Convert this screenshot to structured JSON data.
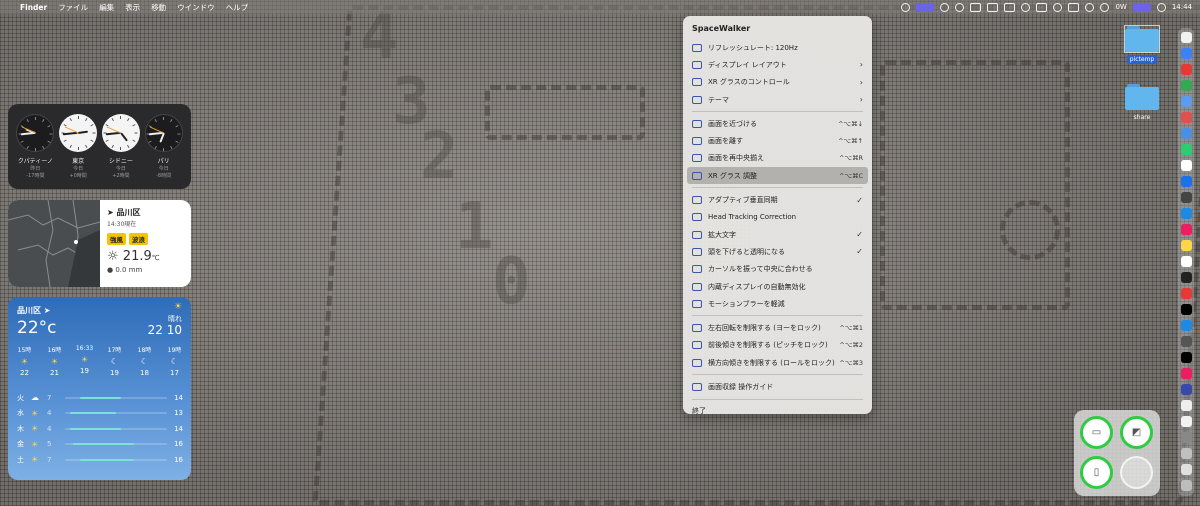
{
  "menubar": {
    "app": "Finder",
    "items": [
      "ファイル",
      "編集",
      "表示",
      "移動",
      "ウインドウ",
      "ヘルプ"
    ],
    "power": "0W",
    "clock": "14:44"
  },
  "world_clock": [
    {
      "city": "クパティーノ",
      "day": "昨日",
      "offset": "-17時間",
      "h": 21,
      "m": 44,
      "dark": true
    },
    {
      "city": "東京",
      "day": "今日",
      "offset": "+0時間",
      "h": 14,
      "m": 44,
      "dark": false
    },
    {
      "city": "シドニー",
      "day": "今日",
      "offset": "+2時間",
      "h": 16,
      "m": 44,
      "dark": false
    },
    {
      "city": "パリ",
      "day": "今日",
      "offset": "-8時間",
      "h": 6,
      "m": 44,
      "dark": true
    }
  ],
  "local_weather": {
    "location": "品川区",
    "updated": "14:30現在",
    "warnings": [
      "強風",
      "波浪"
    ],
    "temp": "21.9",
    "temp_unit": "℃",
    "rain": "0.0",
    "rain_unit": "mm"
  },
  "weather": {
    "location": "品川区",
    "temp": "22°c",
    "condition": "晴れ",
    "hi_lo": "22 10",
    "hourly": [
      {
        "time": "15時",
        "icon": "sun",
        "temp": "22"
      },
      {
        "time": "16時",
        "icon": "sun",
        "temp": "21"
      },
      {
        "time": "16:33",
        "icon": "sun",
        "temp": "19"
      },
      {
        "time": "17時",
        "icon": "moon",
        "temp": "19"
      },
      {
        "time": "18時",
        "icon": "moon",
        "temp": "18"
      },
      {
        "time": "19時",
        "icon": "moon",
        "temp": "17"
      }
    ],
    "daily": [
      {
        "day": "火",
        "icon": "cloud",
        "lo": "7",
        "hi": "14",
        "bar": [
          0.15,
          0.55
        ]
      },
      {
        "day": "水",
        "icon": "sun",
        "lo": "4",
        "hi": "13",
        "bar": [
          0.05,
          0.5
        ]
      },
      {
        "day": "木",
        "icon": "sun",
        "lo": "4",
        "hi": "14",
        "bar": [
          0.05,
          0.55
        ]
      },
      {
        "day": "金",
        "icon": "sun",
        "lo": "5",
        "hi": "16",
        "bar": [
          0.08,
          0.68
        ]
      },
      {
        "day": "土",
        "icon": "sun",
        "lo": "7",
        "hi": "16",
        "bar": [
          0.15,
          0.68
        ]
      }
    ]
  },
  "menu": {
    "title": "SpaceWalker",
    "items": [
      {
        "label": "リフレッシュレート: 120Hz",
        "shortcut": "",
        "chevron": false,
        "check": false,
        "icon": "display-icon"
      },
      {
        "label": "ディスプレイ レイアウト",
        "shortcut": "",
        "chevron": true,
        "check": false,
        "icon": "layout-icon"
      },
      {
        "label": "XR グラスのコントロール",
        "shortcut": "",
        "chevron": true,
        "check": false,
        "icon": "glasses-icon"
      },
      {
        "label": "テーマ",
        "shortcut": "",
        "chevron": true,
        "check": false,
        "icon": "theme-icon",
        "sep_after": true
      },
      {
        "label": "画面を近づける",
        "shortcut": "^⌥⌘↓",
        "chevron": false,
        "check": false,
        "icon": "zoom-in-icon"
      },
      {
        "label": "画面を離す",
        "shortcut": "^⌥⌘↑",
        "chevron": false,
        "check": false,
        "icon": "zoom-out-icon"
      },
      {
        "label": "画面を再中央揃え",
        "shortcut": "^⌥⌘R",
        "chevron": false,
        "check": false,
        "icon": "recenter-icon"
      },
      {
        "label": "XR グラス 調整",
        "shortcut": "^⌥⌘C",
        "chevron": false,
        "check": false,
        "icon": "adjust-icon",
        "selected": true,
        "sep_after": true
      },
      {
        "label": "アダプティブ垂直同期",
        "shortcut": "",
        "chevron": false,
        "check": true,
        "icon": "vsync-icon"
      },
      {
        "label": "Head Tracking Correction",
        "shortcut": "",
        "chevron": false,
        "check": false,
        "icon": "tracking-icon"
      },
      {
        "label": "拡大文字",
        "shortcut": "",
        "chevron": false,
        "check": true,
        "icon": "text-size-icon"
      },
      {
        "label": "頭を下げると透明になる",
        "shortcut": "",
        "chevron": false,
        "check": true,
        "icon": "transparency-icon"
      },
      {
        "label": "カーソルを振って中央に合わせる",
        "shortcut": "",
        "chevron": false,
        "check": false,
        "icon": "cursor-icon"
      },
      {
        "label": "内蔵ディスプレイの自動無効化",
        "shortcut": "",
        "chevron": false,
        "check": false,
        "icon": "builtin-display-icon"
      },
      {
        "label": "モーションブラーを軽減",
        "shortcut": "",
        "chevron": false,
        "check": false,
        "icon": "motion-blur-icon",
        "sep_after": true
      },
      {
        "label": "左右回転を制限する (ヨーをロック)",
        "shortcut": "^⌥⌘1",
        "chevron": false,
        "check": false,
        "icon": "yaw-icon"
      },
      {
        "label": "前後傾きを制限する (ピッチをロック)",
        "shortcut": "^⌥⌘2",
        "chevron": false,
        "check": false,
        "icon": "pitch-icon"
      },
      {
        "label": "横方向傾きを制限する (ロールをロック)",
        "shortcut": "^⌥⌘3",
        "chevron": false,
        "check": false,
        "icon": "roll-icon",
        "sep_after": true
      },
      {
        "label": "画面収録 操作ガイド",
        "shortcut": "",
        "chevron": false,
        "check": false,
        "icon": "record-icon",
        "sep_after": true
      },
      {
        "label": "終了",
        "shortcut": "",
        "chevron": false,
        "check": false,
        "icon": "",
        "plain": true
      }
    ]
  },
  "desktop": {
    "icons": [
      {
        "name": "pictemp",
        "selected": true
      },
      {
        "name": "share",
        "selected": false
      }
    ]
  },
  "dock_colors": [
    "#f2f2f2",
    "#3b82f6",
    "#e53935",
    "#34a853",
    "#5b9cf0",
    "#e05050",
    "#4a90e2",
    "#2ecc71",
    "#ffffff",
    "#1a73e8",
    "#444444",
    "#1e88e5",
    "#e91e63",
    "#ffd54a",
    "#ffffff",
    "#222222",
    "#e53935",
    "#000000",
    "#1e88e5",
    "#555555",
    "#000000",
    "#e91e63",
    "#3949ab",
    "#eeeeee",
    "#f2f2f2",
    "#888888",
    "#c0c0c0",
    "#e0e0e0",
    "#bdbdbd"
  ]
}
